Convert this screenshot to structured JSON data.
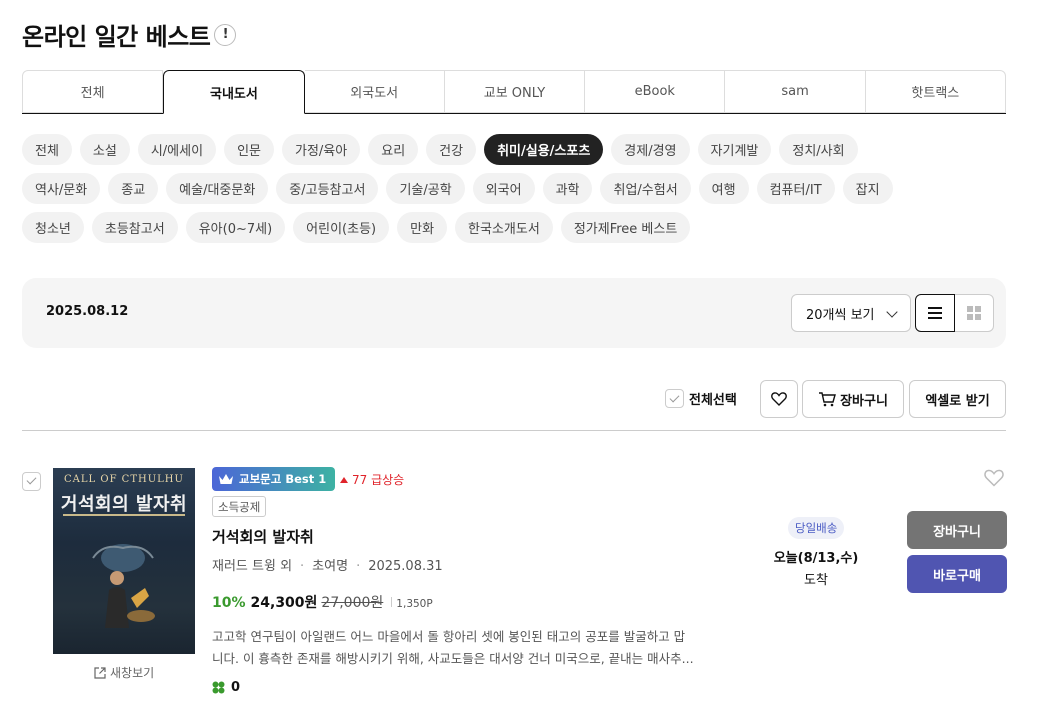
{
  "header": {
    "title": "온라인 일간 베스트",
    "info_icon": "!"
  },
  "tabs": [
    {
      "label": "전체",
      "active": false
    },
    {
      "label": "국내도서",
      "active": true
    },
    {
      "label": "외국도서",
      "active": false
    },
    {
      "label": "교보 ONLY",
      "active": false
    },
    {
      "label": "eBook",
      "active": false
    },
    {
      "label": "sam",
      "active": false
    },
    {
      "label": "핫트랙스",
      "active": false
    }
  ],
  "categories": {
    "row1": [
      "전체",
      "소설",
      "시/에세이",
      "인문",
      "가정/육아",
      "요리",
      "건강",
      "취미/실용/스포츠",
      "경제/경영",
      "자기계발",
      "정치/사회"
    ],
    "row2": [
      "역사/문화",
      "종교",
      "예술/대중문화",
      "중/고등참고서",
      "기술/공학",
      "외국어",
      "과학",
      "취업/수험서",
      "여행",
      "컴퓨터/IT",
      "잡지"
    ],
    "row3": [
      "청소년",
      "초등참고서",
      "유아(0~7세)",
      "어린이(초등)",
      "만화",
      "한국소개도서",
      "정가제Free 베스트"
    ],
    "active": "취미/실용/스포츠"
  },
  "toolbar": {
    "date": "2025.08.12",
    "per_page": "20개씩 보기",
    "view_mode": "list"
  },
  "actions": {
    "select_all": "전체선택",
    "cart": "장바구니",
    "excel": "엑셀로 받기"
  },
  "item": {
    "cover": {
      "series": "CALL OF CTHULHU",
      "title": "거석회의 발자취"
    },
    "new_window": "새창보기",
    "best_badge": "교보문고 Best 1",
    "rank_change": "77 급상승",
    "tag": "소득공제",
    "title": "거석회의 발자취",
    "author": "재러드 트윙 외",
    "translator": "초여명",
    "pub_date": "2025.08.31",
    "discount": "10%",
    "sale_price": "24,300원",
    "original_price": "27,000원",
    "points": "1,350P",
    "description_line1": "고고학 연구팀이 아일랜드 어느 마을에서 돌 항아리 셋에 봉인된 태고의 공포를 발굴하고 맙",
    "description_line2": "니다. 이 흉측한 존재를 해방시키기 위해, 사교도들은 대서양 건너 미국으로, 끝내는 매사추...",
    "clover_count": "0",
    "delivery_badge": "당일배송",
    "delivery_date": "오늘(8/13,수)",
    "delivery_arrive": "도착",
    "cart_button": "장바구니",
    "buy_button": "바로구매"
  },
  "colors": {
    "accent_green": "#3a9a2e",
    "rank_red": "#e0242b",
    "buy_purple": "#5055b1",
    "cart_gray": "#747474"
  }
}
